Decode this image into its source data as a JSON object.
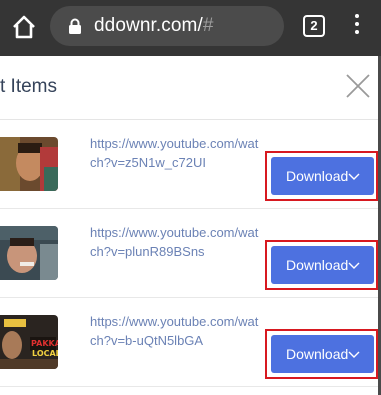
{
  "browser": {
    "url_host": "ddownr.com/",
    "url_hash": "#",
    "tab_count": "2",
    "icons": [
      "home-icon",
      "lock-icon",
      "tabs-icon",
      "menu-icon"
    ]
  },
  "modal": {
    "title": "t Items",
    "close_icon": "close-icon",
    "items": [
      {
        "url": "https://www.youtube.com/watch?v=z5N1w_c72UI",
        "button": "Download"
      },
      {
        "url": "https://www.youtube.com/watch?v=plunR89BSns",
        "button": "Download"
      },
      {
        "url": "https://www.youtube.com/watch?v=b-uQtN5lbGA",
        "button": "Download"
      }
    ]
  },
  "colors": {
    "chrome_bg": "#353535",
    "button": "#4d71e0",
    "highlight_border": "#d71920",
    "link": "#6b82b5"
  }
}
